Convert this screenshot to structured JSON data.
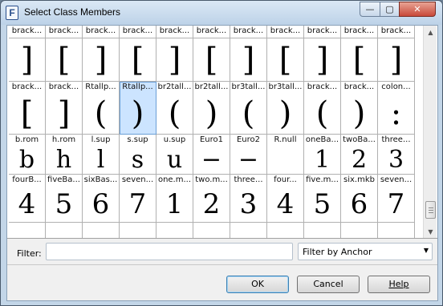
{
  "window": {
    "title": "Select Class Members",
    "app_icon": "F",
    "controls": {
      "minimize": "—",
      "maximize": "▢",
      "close": "✕"
    }
  },
  "grid": {
    "rows": [
      {
        "cells": [
          {
            "label": "brack...",
            "glyph": ""
          },
          {
            "label": "brack...",
            "glyph": ""
          },
          {
            "label": "brack...",
            "glyph": ""
          },
          {
            "label": "brack...",
            "glyph": ""
          },
          {
            "label": "brack...",
            "glyph": ""
          },
          {
            "label": "brack...",
            "glyph": ""
          },
          {
            "label": "brack...",
            "glyph": ""
          },
          {
            "label": "brack...",
            "glyph": ""
          },
          {
            "label": "brack...",
            "glyph": ""
          },
          {
            "label": "brack...",
            "glyph": ""
          },
          {
            "label": "brack...",
            "glyph": ""
          }
        ]
      },
      {
        "cells": [
          {
            "label": "",
            "glyph": "]"
          },
          {
            "label": "",
            "glyph": "["
          },
          {
            "label": "",
            "glyph": "]"
          },
          {
            "label": "",
            "glyph": "["
          },
          {
            "label": "",
            "glyph": "]"
          },
          {
            "label": "",
            "glyph": "["
          },
          {
            "label": "",
            "glyph": "]"
          },
          {
            "label": "",
            "glyph": "["
          },
          {
            "label": "",
            "glyph": "]"
          },
          {
            "label": "",
            "glyph": "["
          },
          {
            "label": "",
            "glyph": "]"
          }
        ]
      },
      {
        "cells": [
          {
            "label": "brack...",
            "glyph": "["
          },
          {
            "label": "brack...",
            "glyph": "]"
          },
          {
            "label": "Rtallp...",
            "glyph": "("
          },
          {
            "label": "Rtallp...",
            "glyph": ")"
          },
          {
            "label": "br2tall...",
            "glyph": "("
          },
          {
            "label": "br2tall...",
            "glyph": ")"
          },
          {
            "label": "br3tall...",
            "glyph": "("
          },
          {
            "label": "br3tall...",
            "glyph": ")"
          },
          {
            "label": "brack...",
            "glyph": "("
          },
          {
            "label": "brack...",
            "glyph": ")"
          },
          {
            "label": "colon...",
            "glyph": ":"
          }
        ]
      },
      {
        "cells": [
          {
            "label": "b.rom",
            "glyph": "b"
          },
          {
            "label": "h.rom",
            "glyph": "h"
          },
          {
            "label": "l.sup",
            "glyph": "l"
          },
          {
            "label": "s.sup",
            "glyph": "s"
          },
          {
            "label": "u.sup",
            "glyph": "u"
          },
          {
            "label": "Euro1",
            "glyph": "−"
          },
          {
            "label": "Euro2",
            "glyph": "−"
          },
          {
            "label": "R.null",
            "glyph": ""
          },
          {
            "label": "oneBa...",
            "glyph": "1"
          },
          {
            "label": "twoBa...",
            "glyph": "2"
          },
          {
            "label": "three...",
            "glyph": "3"
          }
        ]
      },
      {
        "cells": [
          {
            "label": "fourB...",
            "glyph": "4"
          },
          {
            "label": "fiveBa...",
            "glyph": "5"
          },
          {
            "label": "sixBas...",
            "glyph": "6"
          },
          {
            "label": "seven...",
            "glyph": "7"
          },
          {
            "label": "one.m...",
            "glyph": "1"
          },
          {
            "label": "two.m...",
            "glyph": "2"
          },
          {
            "label": "three...",
            "glyph": "3"
          },
          {
            "label": "four...",
            "glyph": "4"
          },
          {
            "label": "five.m...",
            "glyph": "5"
          },
          {
            "label": "six.mkb",
            "glyph": "6"
          },
          {
            "label": "seven...",
            "glyph": "7"
          }
        ]
      }
    ],
    "selected": {
      "row": 2,
      "col": 3
    }
  },
  "filter": {
    "label": "Filter:",
    "value": "",
    "mode_selected": "Filter by Anchor"
  },
  "buttons": {
    "ok": "OK",
    "cancel": "Cancel",
    "help": "Help"
  }
}
